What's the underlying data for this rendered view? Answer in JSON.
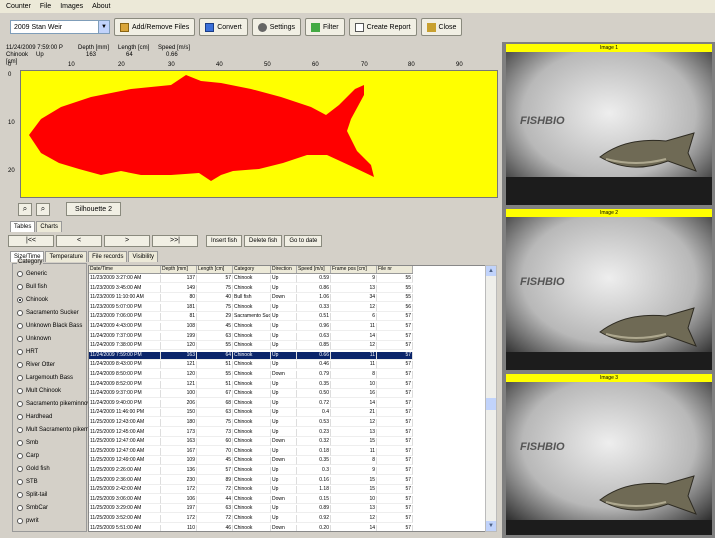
{
  "menu": [
    "Counter",
    "File",
    "Images",
    "About"
  ],
  "toolbar": {
    "combo_value": "2009 Stan Weir",
    "buttons": [
      "Add/Remove Files",
      "Convert",
      "Settings",
      "Filter",
      "Create Report",
      "Close"
    ]
  },
  "info": {
    "datetime": "11/24/2009 7:59:00 P",
    "category_label": "Chinook",
    "category_value": "Up",
    "depth_label": "Depth [mm]",
    "depth_value": "163",
    "length_label": "Length [cm]",
    "length_value": "64",
    "speed_label": "Speed [m/s]",
    "speed_value": "0.66",
    "units_label": "[cm]"
  },
  "ruler_ticks": [
    "0",
    "10",
    "20",
    "30",
    "40",
    "50",
    "60",
    "70",
    "80",
    "90"
  ],
  "vruler_ticks": [
    "0",
    "10",
    "20"
  ],
  "silhouette_button": "Silhouette 2",
  "tabs_top": [
    "Tables",
    "Charts"
  ],
  "nav_buttons": [
    "|<<",
    "<",
    ">",
    ">>|"
  ],
  "action_buttons": [
    "Insert fish",
    "Delete fish",
    "Go to date"
  ],
  "tabs_sub": [
    "Size/Time",
    "Temperature",
    "File records",
    "Visibility"
  ],
  "category_title": "Category",
  "categories": [
    {
      "label": "Generic",
      "checked": false
    },
    {
      "label": "Bull fish",
      "checked": false
    },
    {
      "label": "Chinook",
      "checked": true
    },
    {
      "label": "Sacramento Sucker",
      "checked": false
    },
    {
      "label": "Unknown Black Bass",
      "checked": false
    },
    {
      "label": "Unknown",
      "checked": false
    },
    {
      "label": "HRT",
      "checked": false
    },
    {
      "label": "River Otter",
      "checked": false
    },
    {
      "label": "Largemouth Bass",
      "checked": false
    },
    {
      "label": "Mult Chinook",
      "checked": false
    },
    {
      "label": "Sacramento pikeminnow",
      "checked": false
    },
    {
      "label": "Hardhead",
      "checked": false
    },
    {
      "label": "Mult Sacramento pikeminnow",
      "checked": false
    },
    {
      "label": "Smb",
      "checked": false
    },
    {
      "label": "Carp",
      "checked": false
    },
    {
      "label": "Gold fish",
      "checked": false
    },
    {
      "label": "STB",
      "checked": false
    },
    {
      "label": "Split-tail",
      "checked": false
    },
    {
      "label": "SmbCar",
      "checked": false
    },
    {
      "label": "pwrit",
      "checked": false
    }
  ],
  "table": {
    "columns": [
      "Date/Time",
      "Depth [mm]",
      "Length [cm]",
      "Category",
      "Direction",
      "Speed [m/s]",
      "Frame pos [cm]",
      "File nr"
    ],
    "selected_row": 8,
    "rows": [
      [
        "11/23/2009 3:27:00 AM",
        "137",
        "57",
        "Chinook",
        "Up",
        "0.59",
        "9",
        "55"
      ],
      [
        "11/23/2009 3:45:00 AM",
        "149",
        "75",
        "Chinook",
        "Up",
        "0.86",
        "13",
        "55"
      ],
      [
        "11/23/2009 11:10:00 AM",
        "80",
        "40",
        "Bull fish",
        "Down",
        "1.06",
        "34",
        "55"
      ],
      [
        "11/23/2009 5:07:00 PM",
        "181",
        "75",
        "Chinook",
        "Up",
        "0.33",
        "12",
        "56"
      ],
      [
        "11/23/2009 7:06:00 PM",
        "81",
        "29",
        "Sacramento Suc",
        "Up",
        "0.51",
        "6",
        "57"
      ],
      [
        "11/24/2009 4:43:00 PM",
        "108",
        "45",
        "Chinook",
        "Up",
        "0.96",
        "11",
        "57"
      ],
      [
        "11/24/2009 7:37:00 PM",
        "199",
        "63",
        "Chinook",
        "Up",
        "0.63",
        "14",
        "57"
      ],
      [
        "11/24/2009 7:38:00 PM",
        "120",
        "55",
        "Chinook",
        "Up",
        "0.85",
        "12",
        "57"
      ],
      [
        "11/24/2009 7:59:00 PM",
        "163",
        "64",
        "Chinook",
        "Up",
        "0.66",
        "11",
        "57"
      ],
      [
        "11/24/2009 8:43:00 PM",
        "121",
        "51",
        "Chinook",
        "Up",
        "0.46",
        "11",
        "57"
      ],
      [
        "11/24/2009 8:50:00 PM",
        "120",
        "55",
        "Chinook",
        "Down",
        "0.79",
        "8",
        "57"
      ],
      [
        "11/24/2009 8:52:00 PM",
        "121",
        "51",
        "Chinook",
        "Up",
        "0.35",
        "10",
        "57"
      ],
      [
        "11/24/2009 9:37:00 PM",
        "100",
        "67",
        "Chinook",
        "Up",
        "0.50",
        "16",
        "57"
      ],
      [
        "11/24/2009 9:40:00 PM",
        "206",
        "68",
        "Chinook",
        "Up",
        "0.72",
        "14",
        "57"
      ],
      [
        "11/24/2009 11:46:00 PM",
        "150",
        "63",
        "Chinook",
        "Up",
        "0.4",
        "21",
        "57"
      ],
      [
        "11/25/2009 12:43:00 AM",
        "180",
        "75",
        "Chinook",
        "Up",
        "0.53",
        "12",
        "57"
      ],
      [
        "11/25/2009 12:45:00 AM",
        "173",
        "73",
        "Chinook",
        "Up",
        "0.23",
        "13",
        "57"
      ],
      [
        "11/25/2009 12:47:00 AM",
        "163",
        "60",
        "Chinook",
        "Down",
        "0.32",
        "15",
        "57"
      ],
      [
        "11/25/2009 12:47:00 AM",
        "167",
        "70",
        "Chinook",
        "Up",
        "0.18",
        "11",
        "57"
      ],
      [
        "11/25/2009 12:49:00 AM",
        "109",
        "45",
        "Chinook",
        "Down",
        "0.35",
        "8",
        "57"
      ],
      [
        "11/25/2009 2:26:00 AM",
        "136",
        "57",
        "Chinook",
        "Up",
        "0.3",
        "9",
        "57"
      ],
      [
        "11/25/2009 2:36:00 AM",
        "230",
        "89",
        "Chinook",
        "Up",
        "0.16",
        "15",
        "57"
      ],
      [
        "11/25/2009 2:42:00 AM",
        "172",
        "72",
        "Chinook",
        "Up",
        "1.18",
        "15",
        "57"
      ],
      [
        "11/25/2009 3:06:00 AM",
        "106",
        "44",
        "Chinook",
        "Down",
        "0.15",
        "10",
        "57"
      ],
      [
        "11/25/2009 3:29:00 AM",
        "197",
        "63",
        "Chinook",
        "Up",
        "0.89",
        "13",
        "57"
      ],
      [
        "11/25/2009 3:52:00 AM",
        "172",
        "72",
        "Chinook",
        "Up",
        "0.92",
        "12",
        "57"
      ],
      [
        "11/25/2009 5:51:00 AM",
        "110",
        "46",
        "Chinook",
        "Down",
        "0.20",
        "14",
        "57"
      ]
    ]
  },
  "images": [
    {
      "caption": "Image 1",
      "watermark": "FISHBIO"
    },
    {
      "caption": "Image 2",
      "watermark": "FISHBIO"
    },
    {
      "caption": "Image 3",
      "watermark": "FISHBIO"
    }
  ],
  "colors": {
    "plot_bg": "#ffff00",
    "silhouette": "#ff0000",
    "selection": "#0a246a"
  }
}
